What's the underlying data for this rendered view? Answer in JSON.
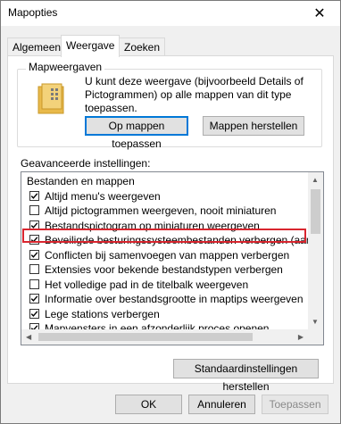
{
  "window": {
    "title": "Mapopties"
  },
  "tabs": [
    {
      "label": "Algemeen",
      "active": false
    },
    {
      "label": "Weergave",
      "active": true
    },
    {
      "label": "Zoeken",
      "active": false
    }
  ],
  "folder_views": {
    "group_label": "Mapweergaven",
    "description": "U kunt deze weergave (bijvoorbeeld Details of Pictogrammen) op alle mappen van dit type toepassen.",
    "apply_button": "Op mappen toepassen",
    "reset_button": "Mappen herstellen"
  },
  "advanced": {
    "label": "Geavanceerde instellingen:",
    "items": [
      {
        "label": "Bestanden en mappen",
        "type": "header",
        "checked": false
      },
      {
        "label": "Altijd menu's weergeven",
        "type": "checkbox",
        "checked": true
      },
      {
        "label": "Altijd pictogrammen weergeven, nooit miniaturen",
        "type": "checkbox",
        "checked": false
      },
      {
        "label": "Bestandspictogram op miniaturen weergeven",
        "type": "checkbox",
        "checked": true
      },
      {
        "label": "Beveiligde besturingssysteembestanden verbergen (aanbevolen)",
        "type": "checkbox",
        "checked": true
      },
      {
        "label": "Conflicten bij samenvoegen van mappen verbergen",
        "type": "checkbox",
        "checked": true
      },
      {
        "label": "Extensies voor bekende bestandstypen verbergen",
        "type": "checkbox",
        "checked": false
      },
      {
        "label": "Het volledige pad in de titelbalk weergeven",
        "type": "checkbox",
        "checked": false
      },
      {
        "label": "Informatie over bestandsgrootte in maptips weergeven",
        "type": "checkbox",
        "checked": true
      },
      {
        "label": "Lege stations verbergen",
        "type": "checkbox",
        "checked": true
      },
      {
        "label": "Mapvensters in een afzonderlijk proces openen",
        "type": "checkbox",
        "checked": true
      }
    ],
    "restore_defaults_button": "Standaardinstellingen herstellen"
  },
  "footer": {
    "ok": "OK",
    "cancel": "Annuleren",
    "apply": "Toepassen"
  },
  "colors": {
    "highlight": "#d9262f",
    "focus": "#0078d7",
    "check": "#000000"
  }
}
